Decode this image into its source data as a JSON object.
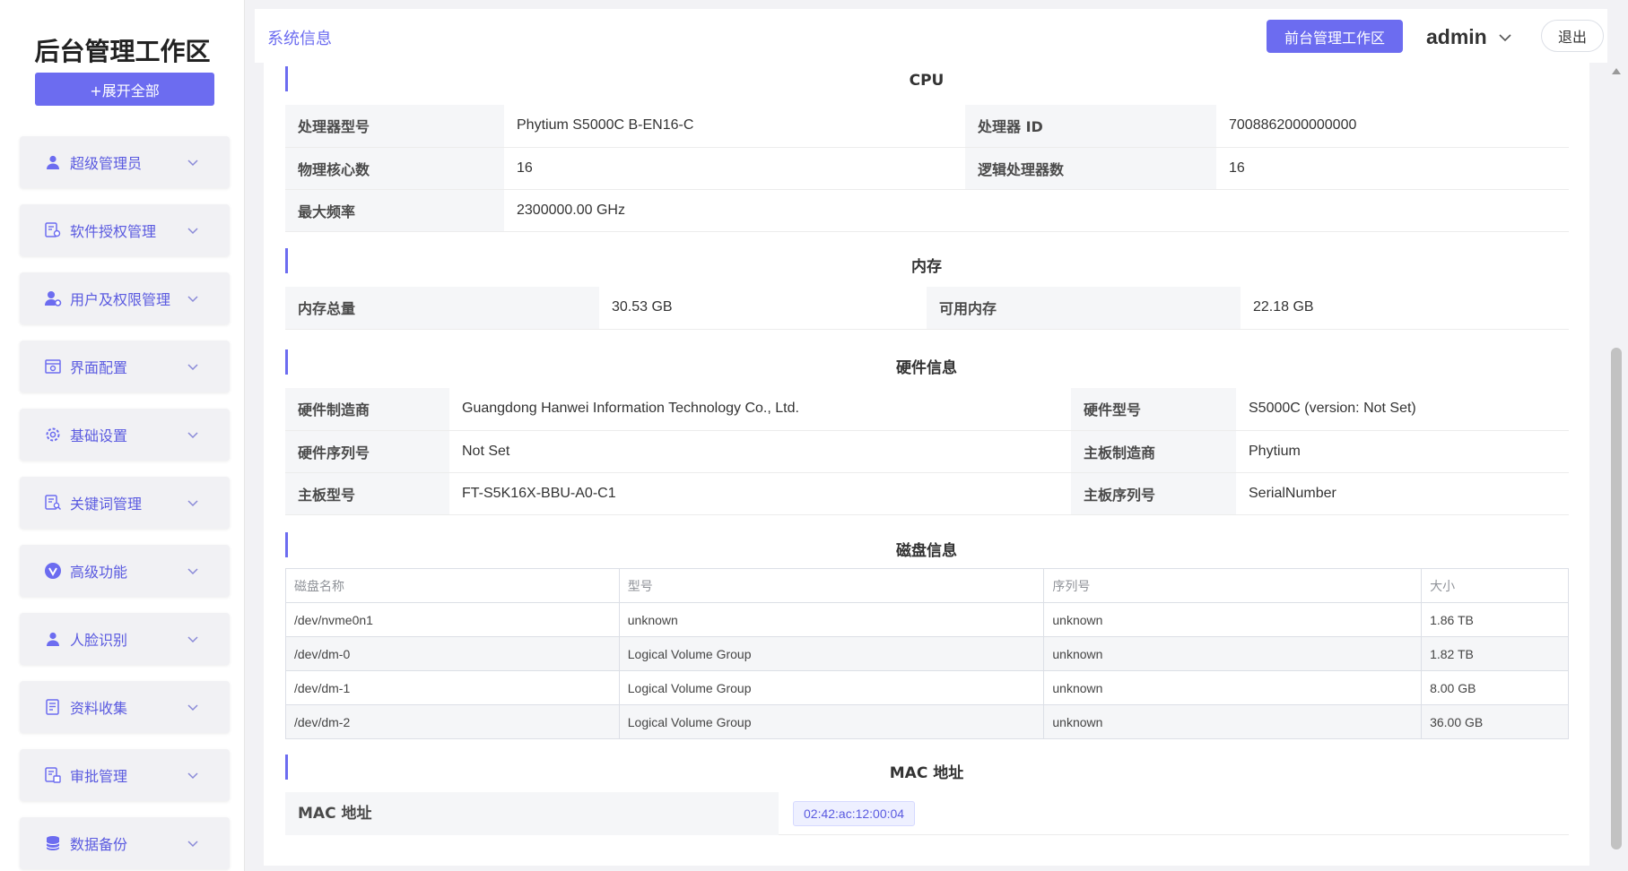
{
  "sidebar": {
    "brand": "后台管理工作区",
    "expand_all": "+展开全部",
    "items": [
      {
        "label": "超级管理员",
        "icon": "user-icon"
      },
      {
        "label": "软件授权管理",
        "icon": "license-icon"
      },
      {
        "label": "用户及权限管理",
        "icon": "user-permission-icon"
      },
      {
        "label": "界面配置",
        "icon": "interface-icon"
      },
      {
        "label": "基础设置",
        "icon": "gear-icon"
      },
      {
        "label": "关键词管理",
        "icon": "keyword-icon"
      },
      {
        "label": "高级功能",
        "icon": "advanced-icon"
      },
      {
        "label": "人脸识别",
        "icon": "face-icon"
      },
      {
        "label": "资料收集",
        "icon": "document-icon"
      },
      {
        "label": "审批管理",
        "icon": "approval-icon"
      },
      {
        "label": "数据备份",
        "icon": "database-icon"
      }
    ]
  },
  "header": {
    "title": "系统信息",
    "front_button": "前台管理工作区",
    "user": "admin",
    "logout": "退出"
  },
  "cpu": {
    "title": "CPU",
    "model_label": "处理器型号",
    "model": "Phytium S5000C B-EN16-C",
    "id_label": "处理器 ID",
    "id": "7008862000000000",
    "cores_label": "物理核心数",
    "cores": "16",
    "logical_label": "逻辑处理器数",
    "logical": "16",
    "freq_label": "最大频率",
    "freq": "2300000.00 GHz"
  },
  "memory": {
    "title": "内存",
    "total_label": "内存总量",
    "total": "30.53 GB",
    "available_label": "可用内存",
    "available": "22.18 GB"
  },
  "hardware": {
    "title": "硬件信息",
    "maker_label": "硬件制造商",
    "maker": "Guangdong Hanwei Information Technology Co., Ltd.",
    "model_label": "硬件型号",
    "model": "S5000C (version: Not Set)",
    "serial_label": "硬件序列号",
    "serial": "Not Set",
    "board_maker_label": "主板制造商",
    "board_maker": "Phytium",
    "board_model_label": "主板型号",
    "board_model": "FT-S5K16X-BBU-A0-C1",
    "board_serial_label": "主板序列号",
    "board_serial": "SerialNumber"
  },
  "disks": {
    "title": "磁盘信息",
    "columns": [
      "磁盘名称",
      "型号",
      "序列号",
      "大小"
    ],
    "rows": [
      [
        "/dev/nvme0n1",
        "unknown",
        "unknown",
        "1.86 TB"
      ],
      [
        "/dev/dm-0",
        "Logical Volume Group",
        "unknown",
        "1.82 TB"
      ],
      [
        "/dev/dm-1",
        "Logical Volume Group",
        "unknown",
        "8.00 GB"
      ],
      [
        "/dev/dm-2",
        "Logical Volume Group",
        "unknown",
        "36.00 GB"
      ]
    ]
  },
  "mac": {
    "title": "MAC 地址",
    "label": "MAC 地址",
    "value": "02:42:ac:12:00:04"
  },
  "colors": {
    "accent": "#6c6cf0",
    "menu_text": "#5a5ae0",
    "key_bg": "#f5f6f8"
  }
}
